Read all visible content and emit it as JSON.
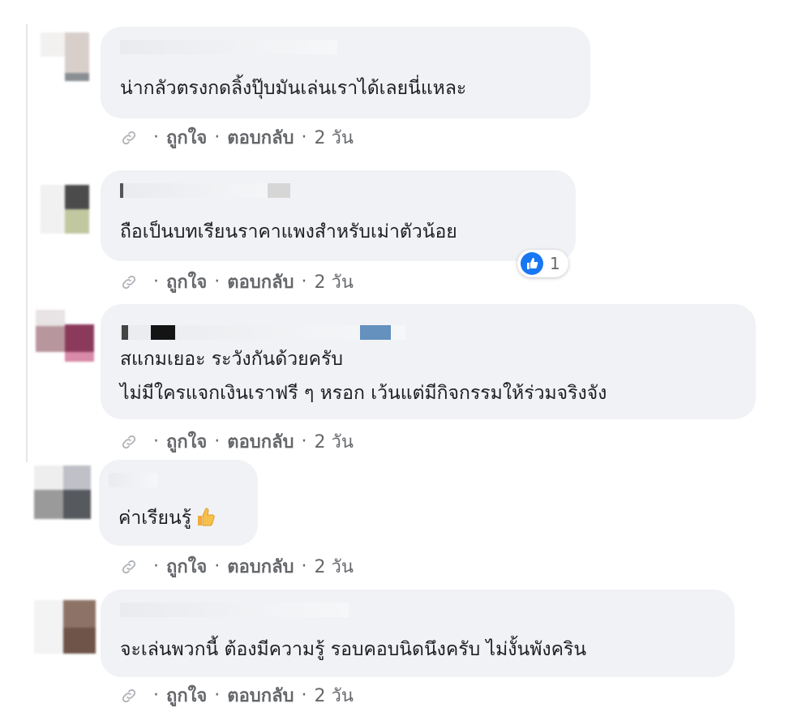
{
  "comments": [
    {
      "text_lines": [
        "น่ากลัวตรงกดลิ้งปุ๊บมันเล่นเราได้เลยนี่แหละ"
      ],
      "actions": {
        "like": "ถูกใจ",
        "reply": "ตอบกลับ",
        "time": "2 วัน"
      }
    },
    {
      "text_lines": [
        "ถือเป็นบทเรียนราคาแพงสำหรับเม่าตัวน้อย"
      ],
      "reaction": {
        "icon": "like-icon",
        "count": "1"
      },
      "actions": {
        "like": "ถูกใจ",
        "reply": "ตอบกลับ",
        "time": "2 วัน"
      }
    },
    {
      "text_lines": [
        "สแกมเยอะ ระวังกันด้วยครับ",
        "ไม่มีใครแจกเงินเราฟรี ๆ หรอก เว้นแต่มีกิจกรรมให้ร่วมจริงจัง"
      ],
      "actions": {
        "like": "ถูกใจ",
        "reply": "ตอบกลับ",
        "time": "2 วัน"
      }
    },
    {
      "text_lines": [
        "ค่าเรียนรู้"
      ],
      "emoji": "thumbs-up-emoji",
      "actions": {
        "like": "ถูกใจ",
        "reply": "ตอบกลับ",
        "time": "2 วัน"
      }
    },
    {
      "text_lines": [
        "จะเล่นพวกนี้ ต้องมีความรู้ รอบคอบนิดนึงครับ ไม่งั้นพังคริน"
      ],
      "actions": {
        "like": "ถูกใจ",
        "reply": "ตอบกลับ",
        "time": "2 วัน"
      }
    }
  ],
  "colors": {
    "bubble": "#f0f2f5",
    "action_text": "#65676b",
    "like_blue": "#1877f2"
  }
}
